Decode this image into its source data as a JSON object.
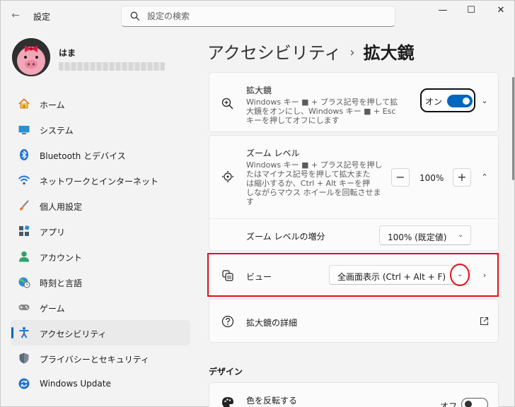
{
  "window": {
    "app_title": "設定",
    "back_label": "←",
    "minimize": "—",
    "maximize": "☐",
    "close": "✕"
  },
  "search": {
    "placeholder": "設定の検索"
  },
  "profile": {
    "name": "はま"
  },
  "sidebar": {
    "items": [
      {
        "label": "ホーム",
        "icon": "home-icon"
      },
      {
        "label": "システム",
        "icon": "system-icon"
      },
      {
        "label": "Bluetooth とデバイス",
        "icon": "bluetooth-icon"
      },
      {
        "label": "ネットワークとインターネット",
        "icon": "network-icon"
      },
      {
        "label": "個人用設定",
        "icon": "brush-icon"
      },
      {
        "label": "アプリ",
        "icon": "apps-icon"
      },
      {
        "label": "アカウント",
        "icon": "account-icon"
      },
      {
        "label": "時刻と言語",
        "icon": "globe-clock-icon"
      },
      {
        "label": "ゲーム",
        "icon": "gamepad-icon"
      },
      {
        "label": "アクセシビリティ",
        "icon": "accessibility-icon",
        "active": true
      },
      {
        "label": "プライバシーとセキュリティ",
        "icon": "shield-icon"
      },
      {
        "label": "Windows Update",
        "icon": "update-icon"
      }
    ]
  },
  "header": {
    "breadcrumb_parent": "アクセシビリティ",
    "breadcrumb_sep": "›",
    "title": "拡大鏡"
  },
  "magnifier": {
    "title": "拡大鏡",
    "desc_lines": [
      "Windows キー ■ + プラス記号を押して拡",
      "大鏡をオンにし、Windows キー ■ + Esc",
      "キーを押してオフにします"
    ],
    "toggle_label": "オン",
    "toggle_state": "on"
  },
  "zoom": {
    "title": "ズーム レベル",
    "desc_lines": [
      "Windows キー ■ + プラス記号を押し",
      "たはマイナス記号を押して拡大また",
      "は縮小するか、Ctrl + Alt キーを押",
      "しながらマウス ホイールを回転させま",
      "す"
    ],
    "value": "100%",
    "minus": "−",
    "plus": "+",
    "increment_label": "ズーム レベルの増分",
    "increment_value": "100% (既定値)"
  },
  "view": {
    "title": "ビュー",
    "selected": "全画面表示 (Ctrl + Alt + F)"
  },
  "details": {
    "title": "拡大鏡の詳細"
  },
  "design": {
    "section_title": "デザイン",
    "invert_title": "色を反転する",
    "invert_state": "オフ"
  },
  "colors": {
    "accent": "#0067c0",
    "highlight": "#e3121c"
  }
}
